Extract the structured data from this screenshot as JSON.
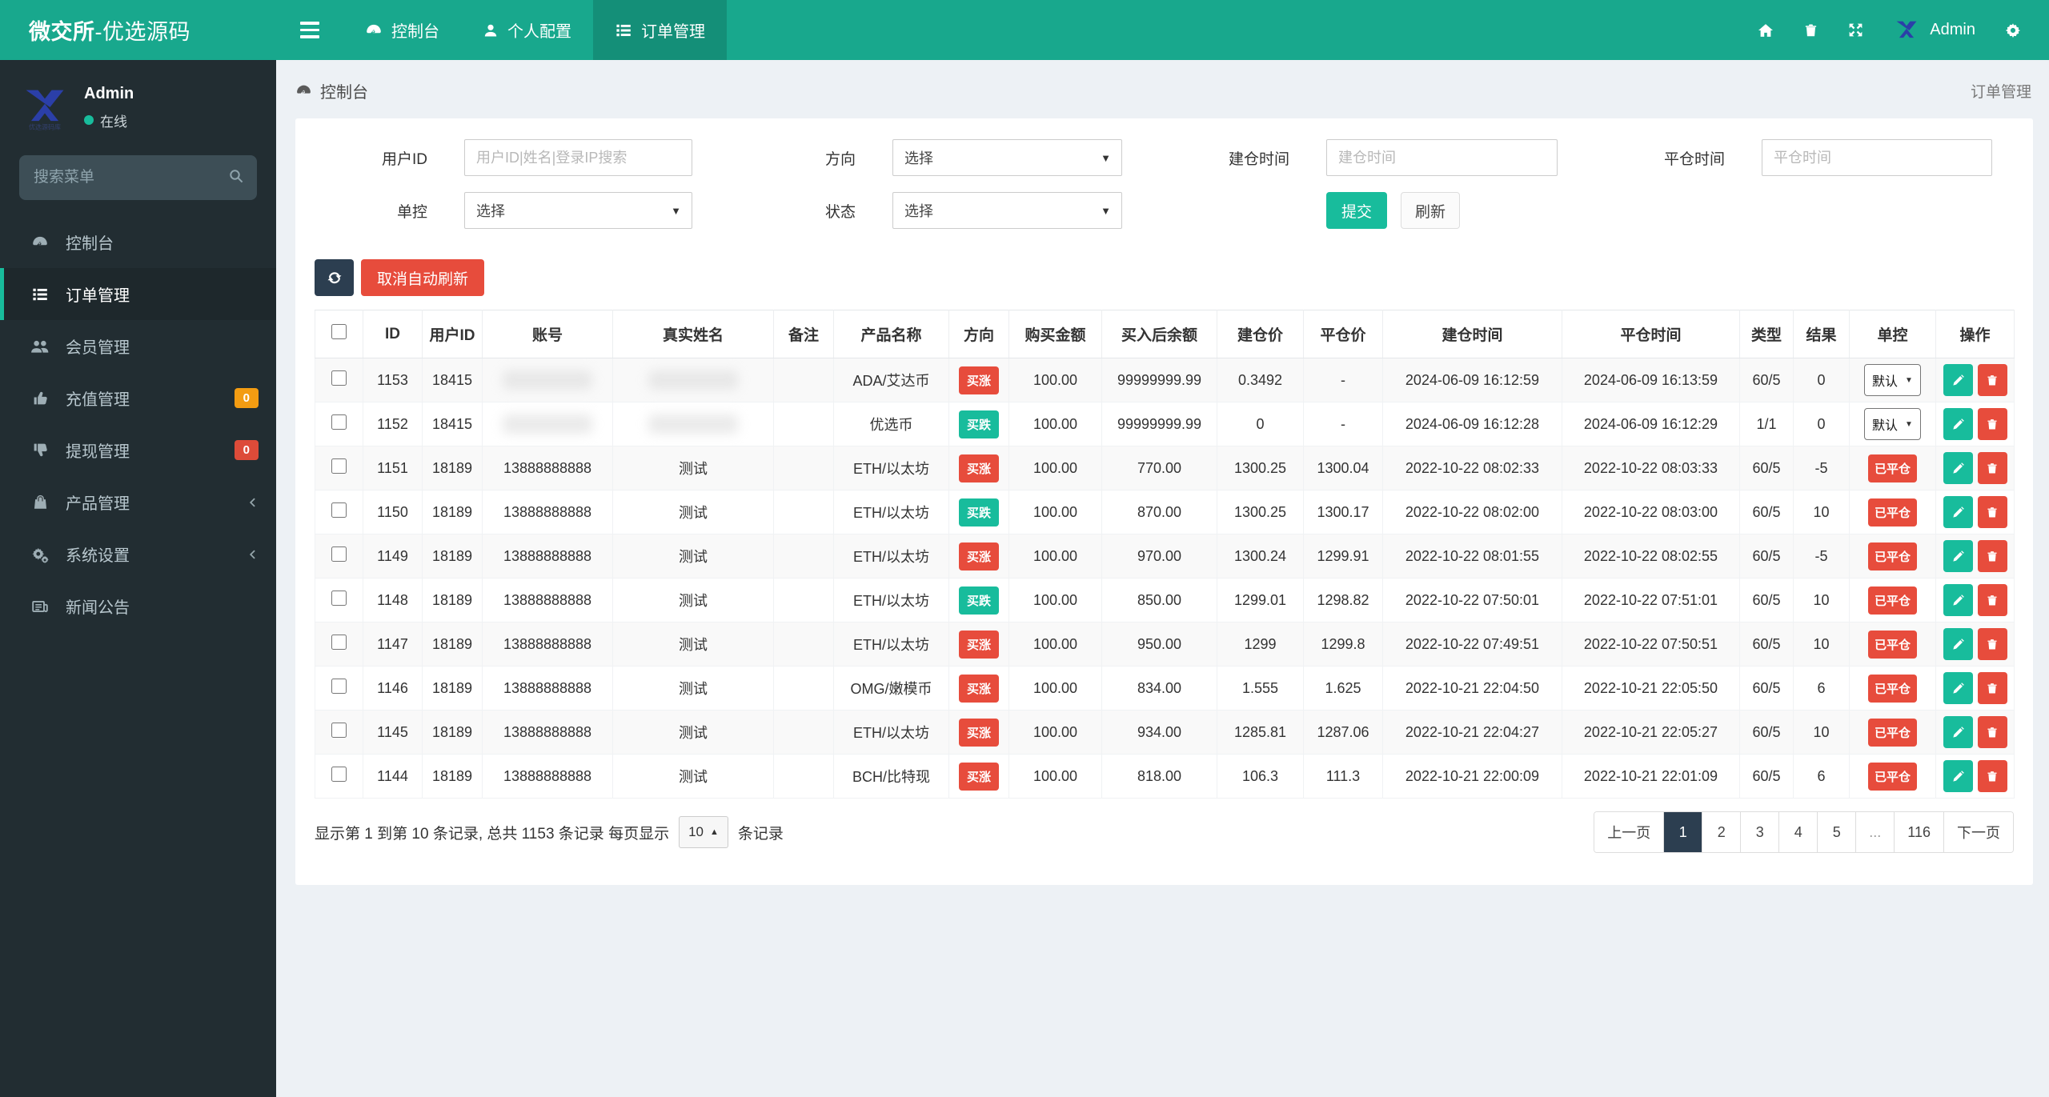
{
  "navbar": {
    "brand_bold": "微交所",
    "brand_rest": "-优选源码",
    "items": [
      {
        "label": "控制台",
        "icon": "dashboard",
        "active": false
      },
      {
        "label": "个人配置",
        "icon": "user",
        "active": false
      },
      {
        "label": "订单管理",
        "icon": "list-ol",
        "active": true
      }
    ],
    "right_icons": [
      "home",
      "trash",
      "expand"
    ],
    "user_label": "Admin",
    "gear_icon": "gear"
  },
  "sidebar": {
    "user": {
      "name": "Admin",
      "status": "在线"
    },
    "search_placeholder": "搜索菜单",
    "items": [
      {
        "label": "控制台",
        "icon": "dashboard"
      },
      {
        "label": "订单管理",
        "icon": "list-ol",
        "active": true
      },
      {
        "label": "会员管理",
        "icon": "users"
      },
      {
        "label": "充值管理",
        "icon": "thumb-up",
        "badge": "0",
        "badge_color": "#f39c12"
      },
      {
        "label": "提现管理",
        "icon": "thumb-down",
        "badge": "0",
        "badge_color": "#dd4b39"
      },
      {
        "label": "产品管理",
        "icon": "bag",
        "chevron": true
      },
      {
        "label": "系统设置",
        "icon": "gears",
        "chevron": true
      },
      {
        "label": "新闻公告",
        "icon": "news"
      }
    ]
  },
  "breadcrumb": {
    "left": "控制台",
    "right": "订单管理"
  },
  "filters": {
    "user_id_label": "用户ID",
    "user_id_placeholder": "用户ID|姓名|登录IP搜索",
    "direction_label": "方向",
    "direction_value": "选择",
    "open_time_label": "建仓时间",
    "open_time_placeholder": "建仓时间",
    "close_time_label": "平仓时间",
    "close_time_placeholder": "平仓时间",
    "control_label": "单控",
    "control_value": "选择",
    "status_label": "状态",
    "status_value": "选择",
    "submit_label": "提交",
    "refresh_label": "刷新"
  },
  "toolbar": {
    "cancel_auto_refresh": "取消自动刷新"
  },
  "table": {
    "headers": [
      "ID",
      "用户ID",
      "账号",
      "真实姓名",
      "备注",
      "产品名称",
      "方向",
      "购买金额",
      "买入后余额",
      "建仓价",
      "平仓价",
      "建仓时间",
      "平仓时间",
      "类型",
      "结果",
      "单控",
      "操作"
    ],
    "columns": [
      "id",
      "uid",
      "account",
      "name",
      "remark",
      "product",
      "direction",
      "amount",
      "balance",
      "open_price",
      "close_price",
      "open_time",
      "close_time",
      "type",
      "result",
      "control",
      "actions"
    ],
    "direction_colors": {
      "买涨": "#e74c3c",
      "买跌": "#18bc9c"
    },
    "closed_badge_color": "#e74c3c",
    "rows": [
      {
        "id": "1153",
        "uid": "18415",
        "account": "",
        "name": "",
        "redacted": true,
        "remark": "",
        "product": "ADA/艾达币",
        "direction": "买涨",
        "amount": "100.00",
        "balance": "99999999.99",
        "open_price": "0.3492",
        "close_price": "-",
        "open_time": "2024-06-09 16:12:59",
        "close_time": "2024-06-09 16:13:59",
        "type": "60/5",
        "result": "0",
        "control": "默认",
        "control_type": "select"
      },
      {
        "id": "1152",
        "uid": "18415",
        "account": "",
        "name": "",
        "redacted": true,
        "remark": "",
        "product": "优选币",
        "direction": "买跌",
        "amount": "100.00",
        "balance": "99999999.99",
        "open_price": "0",
        "close_price": "-",
        "open_time": "2024-06-09 16:12:28",
        "close_time": "2024-06-09 16:12:29",
        "type": "1/1",
        "result": "0",
        "control": "默认",
        "control_type": "select"
      },
      {
        "id": "1151",
        "uid": "18189",
        "account": "13888888888",
        "name": "测试",
        "remark": "",
        "product": "ETH/以太坊",
        "direction": "买涨",
        "amount": "100.00",
        "balance": "770.00",
        "open_price": "1300.25",
        "close_price": "1300.04",
        "open_time": "2022-10-22 08:02:33",
        "close_time": "2022-10-22 08:03:33",
        "type": "60/5",
        "result": "-5",
        "control": "已平仓",
        "control_type": "badge"
      },
      {
        "id": "1150",
        "uid": "18189",
        "account": "13888888888",
        "name": "测试",
        "remark": "",
        "product": "ETH/以太坊",
        "direction": "买跌",
        "amount": "100.00",
        "balance": "870.00",
        "open_price": "1300.25",
        "close_price": "1300.17",
        "open_time": "2022-10-22 08:02:00",
        "close_time": "2022-10-22 08:03:00",
        "type": "60/5",
        "result": "10",
        "control": "已平仓",
        "control_type": "badge"
      },
      {
        "id": "1149",
        "uid": "18189",
        "account": "13888888888",
        "name": "测试",
        "remark": "",
        "product": "ETH/以太坊",
        "direction": "买涨",
        "amount": "100.00",
        "balance": "970.00",
        "open_price": "1300.24",
        "close_price": "1299.91",
        "open_time": "2022-10-22 08:01:55",
        "close_time": "2022-10-22 08:02:55",
        "type": "60/5",
        "result": "-5",
        "control": "已平仓",
        "control_type": "badge"
      },
      {
        "id": "1148",
        "uid": "18189",
        "account": "13888888888",
        "name": "测试",
        "remark": "",
        "product": "ETH/以太坊",
        "direction": "买跌",
        "amount": "100.00",
        "balance": "850.00",
        "open_price": "1299.01",
        "close_price": "1298.82",
        "open_time": "2022-10-22 07:50:01",
        "close_time": "2022-10-22 07:51:01",
        "type": "60/5",
        "result": "10",
        "control": "已平仓",
        "control_type": "badge"
      },
      {
        "id": "1147",
        "uid": "18189",
        "account": "13888888888",
        "name": "测试",
        "remark": "",
        "product": "ETH/以太坊",
        "direction": "买涨",
        "amount": "100.00",
        "balance": "950.00",
        "open_price": "1299",
        "close_price": "1299.8",
        "open_time": "2022-10-22 07:49:51",
        "close_time": "2022-10-22 07:50:51",
        "type": "60/5",
        "result": "10",
        "control": "已平仓",
        "control_type": "badge"
      },
      {
        "id": "1146",
        "uid": "18189",
        "account": "13888888888",
        "name": "测试",
        "remark": "",
        "product": "OMG/嫩模币",
        "direction": "买涨",
        "amount": "100.00",
        "balance": "834.00",
        "open_price": "1.555",
        "close_price": "1.625",
        "open_time": "2022-10-21 22:04:50",
        "close_time": "2022-10-21 22:05:50",
        "type": "60/5",
        "result": "6",
        "control": "已平仓",
        "control_type": "badge"
      },
      {
        "id": "1145",
        "uid": "18189",
        "account": "13888888888",
        "name": "测试",
        "remark": "",
        "product": "ETH/以太坊",
        "direction": "买涨",
        "amount": "100.00",
        "balance": "934.00",
        "open_price": "1285.81",
        "close_price": "1287.06",
        "open_time": "2022-10-21 22:04:27",
        "close_time": "2022-10-21 22:05:27",
        "type": "60/5",
        "result": "10",
        "control": "已平仓",
        "control_type": "badge"
      },
      {
        "id": "1144",
        "uid": "18189",
        "account": "13888888888",
        "name": "测试",
        "remark": "",
        "product": "BCH/比特现",
        "direction": "买涨",
        "amount": "100.00",
        "balance": "818.00",
        "open_price": "106.3",
        "close_price": "111.3",
        "open_time": "2022-10-21 22:00:09",
        "close_time": "2022-10-21 22:01:09",
        "type": "60/5",
        "result": "6",
        "control": "已平仓",
        "control_type": "badge"
      }
    ]
  },
  "footer": {
    "summary_prefix": "显示第 1 到第 10 条记录, 总共 1153 条记录 每页显示",
    "page_size": "10",
    "summary_suffix": "条记录",
    "pagination": [
      "上一页",
      "1",
      "2",
      "3",
      "4",
      "5",
      "...",
      "116",
      "下一页"
    ],
    "active_page": "1"
  }
}
